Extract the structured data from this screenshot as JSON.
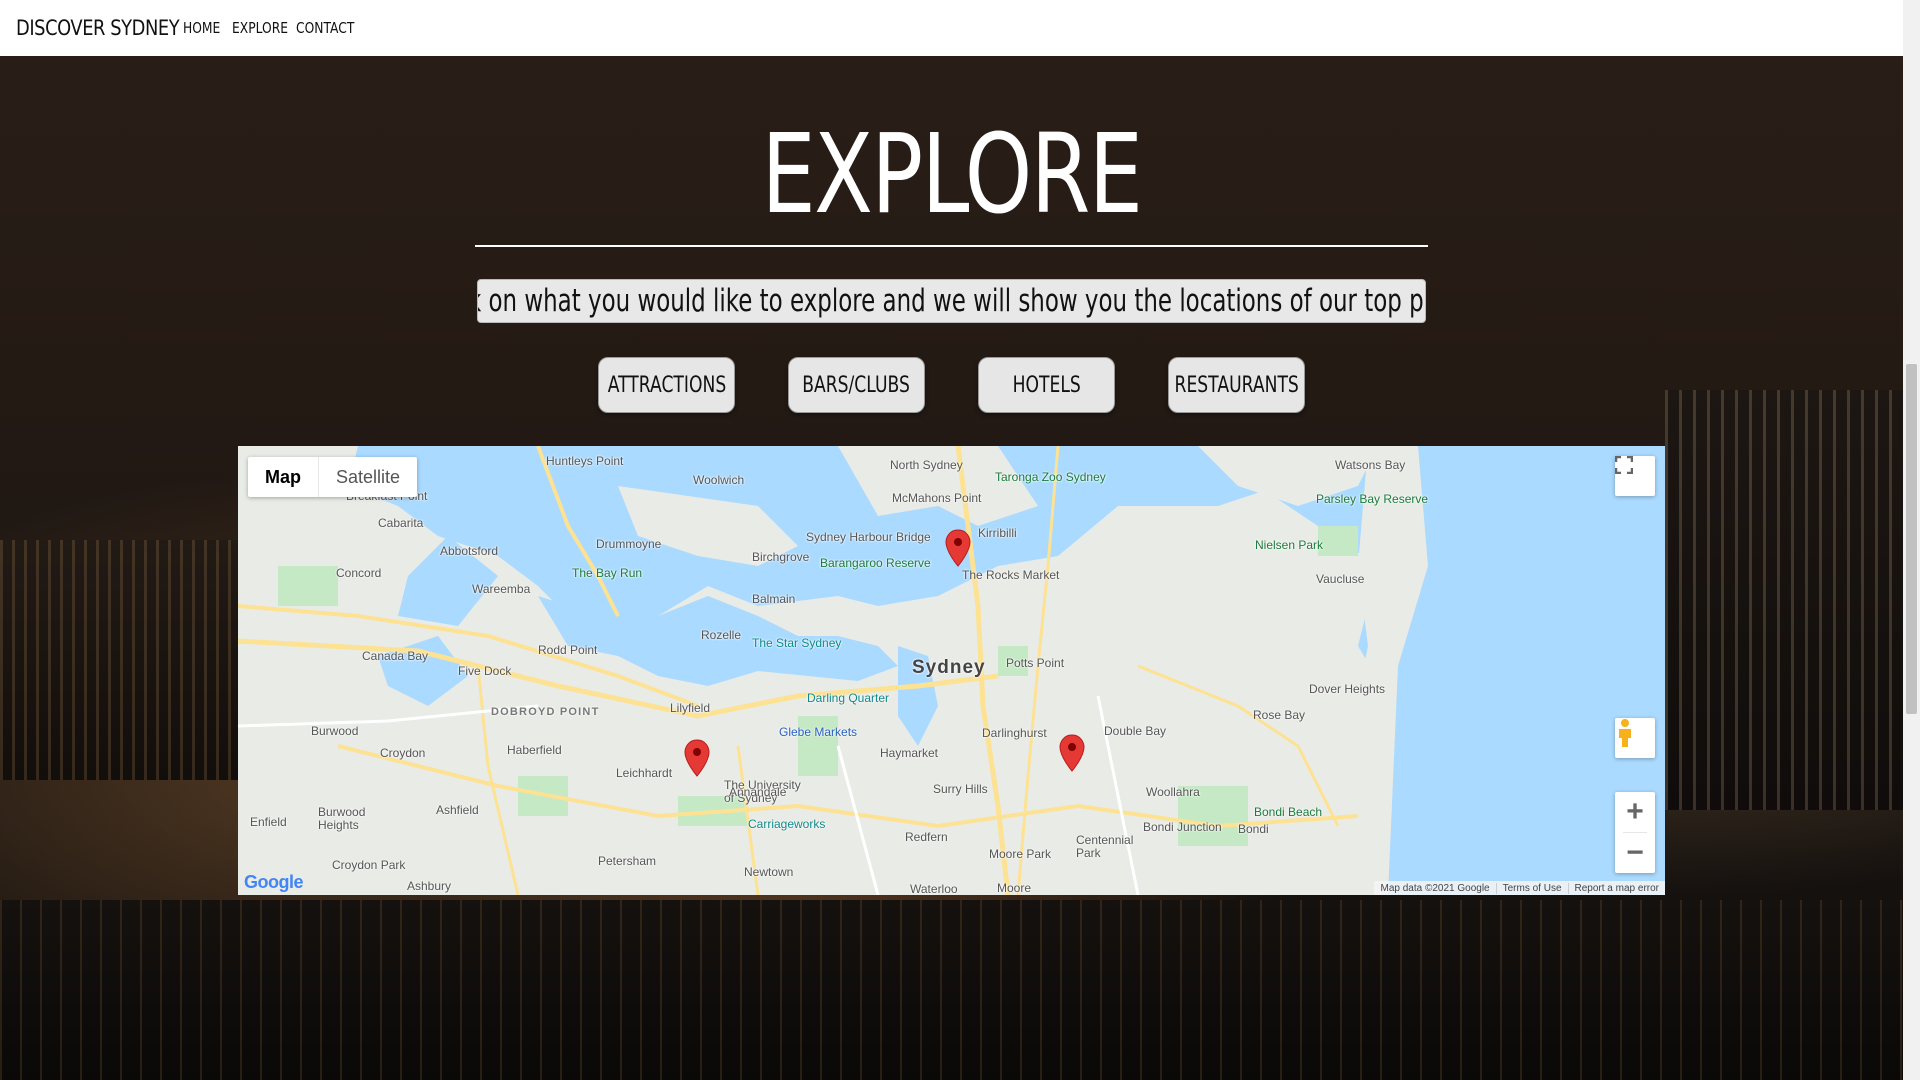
{
  "nav": {
    "brand": "DISCOVER SYDNEY",
    "links": [
      "HOME",
      "EXPLORE",
      "CONTACT"
    ]
  },
  "hero": {
    "title": "EXPLORE",
    "subtitle": "Click on what you would like to explore and we will show you the locations of our top picks!"
  },
  "categories": [
    "ATTRACTIONS",
    "BARS/CLUBS",
    "HOTELS",
    "RESTAURANTS"
  ],
  "map": {
    "type_controls": {
      "map": "Map",
      "satellite": "Satellite"
    },
    "zoom_in": "+",
    "zoom_out": "−",
    "logo": "Google",
    "footer": {
      "data": "Map data ©2021 Google",
      "terms": "Terms of Use",
      "report": "Report a map error"
    },
    "labels": {
      "huntleys_point": "Huntleys Point",
      "woolwich": "Woolwich",
      "north_sydney": "North Sydney",
      "taronga": "Taronga Zoo Sydney",
      "watsons_bay": "Watsons Bay",
      "breakfast_point": "Breakfast Point",
      "mcmahons_point": "McMahons Point",
      "cabarita": "Cabarita",
      "kirribilli": "Kirribilli",
      "parsley_bay": "Parsley Bay Reserve",
      "drummoyne": "Drummoyne",
      "harbour_bridge": "Sydney Harbour Bridge",
      "abbotsford": "Abbotsford",
      "birchgrove": "Birchgrove",
      "barangaroo": "Barangaroo Reserve",
      "nielsen_park": "Nielsen Park",
      "concord": "Concord",
      "bay_run": "The Bay Run",
      "rocks_market": "The Rocks Market",
      "wareemba": "Wareemba",
      "balmain": "Balmain",
      "vaucluse": "Vaucluse",
      "rozelle": "Rozelle",
      "star": "The Star Sydney",
      "canada_bay": "Canada Bay",
      "rodd_point": "Rodd Point",
      "five_dock": "Five Dock",
      "sydney": "Sydney",
      "potts_point": "Potts Point",
      "dover_heights": "Dover Heights",
      "dobroyd": "DOBROYD POINT",
      "lilyfield": "Lilyfield",
      "darling_quarter": "Darling Quarter",
      "rose_bay": "Rose Bay",
      "burwood": "Burwood",
      "glebe": "Glebe Markets",
      "darlinghurst": "Darlinghurst",
      "double_bay": "Double Bay",
      "croydon": "Croydon",
      "haberfield": "Haberfield",
      "haymarket": "Haymarket",
      "leichhardt": "Leichhardt",
      "uni": "The University of Sydney",
      "surry_hills": "Surry Hills",
      "woollahra": "Woollahra",
      "annandale": "Annandale",
      "enfield": "Enfield",
      "burwood_heights": "Burwood Heights",
      "ashfield": "Ashfield",
      "carriageworks": "Carriageworks",
      "bondi_beach": "Bondi Beach",
      "bondi_junction": "Bondi Junction",
      "bondi": "Bondi",
      "redfern": "Redfern",
      "centennial": "Centennial Park",
      "croydon_park": "Croydon Park",
      "petersham": "Petersham",
      "moore_park": "Moore Park",
      "newtown": "Newtown",
      "ashbury": "Ashbury",
      "waterloo": "Waterloo",
      "moore": "Moore"
    }
  },
  "colors": {
    "accent_marker": "#e53935",
    "water": "#aadaff",
    "park": "#c5e8c5",
    "road": "#fde293"
  },
  "icons": [
    "fullscreen-icon",
    "pegman-icon",
    "map-marker-icon",
    "zoom-in-icon",
    "zoom-out-icon"
  ]
}
